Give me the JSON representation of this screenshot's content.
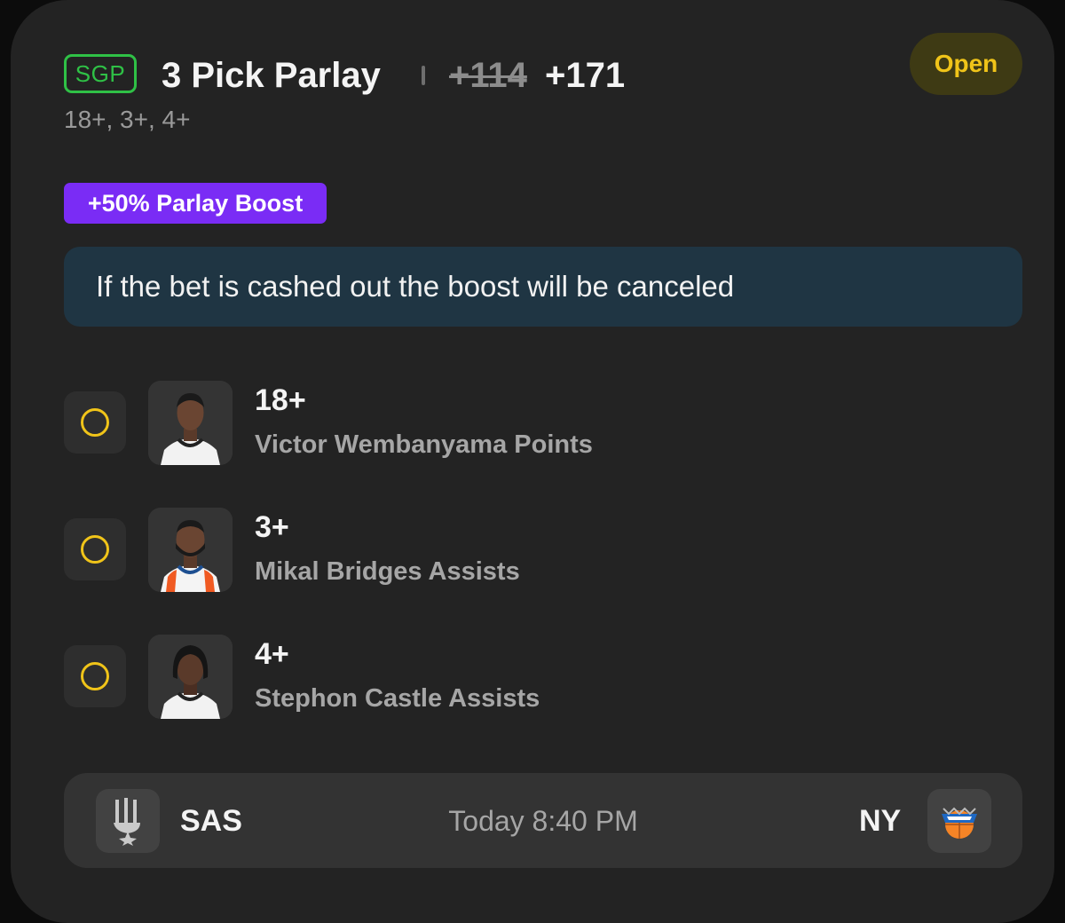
{
  "header": {
    "badge": "SGP",
    "title": "3 Pick Parlay",
    "original_odds": "+114",
    "boosted_odds": "+171",
    "subtitle": "18+, 3+, 4+",
    "status": "Open"
  },
  "boost_tag": "+50% Parlay Boost",
  "notice": "If the bet is cashed out the boost will be canceled",
  "legs": [
    {
      "line": "18+",
      "market": "Victor Wembanyama Points",
      "jersey": "white"
    },
    {
      "line": "3+",
      "market": "Mikal Bridges Assists",
      "jersey": "knicks"
    },
    {
      "line": "4+",
      "market": "Stephon Castle Assists",
      "jersey": "white"
    }
  ],
  "game": {
    "away_team": "SAS",
    "time": "Today 8:40 PM",
    "home_team": "NY",
    "away_logo": "spurs-logo-icon",
    "home_logo": "knicks-logo-icon"
  },
  "colors": {
    "card_bg": "#232323",
    "sgp_green": "#2fc146",
    "status_yellow": "#f0c419",
    "boost_purple": "#7a2cf5",
    "notice_bg": "#1f3543"
  }
}
